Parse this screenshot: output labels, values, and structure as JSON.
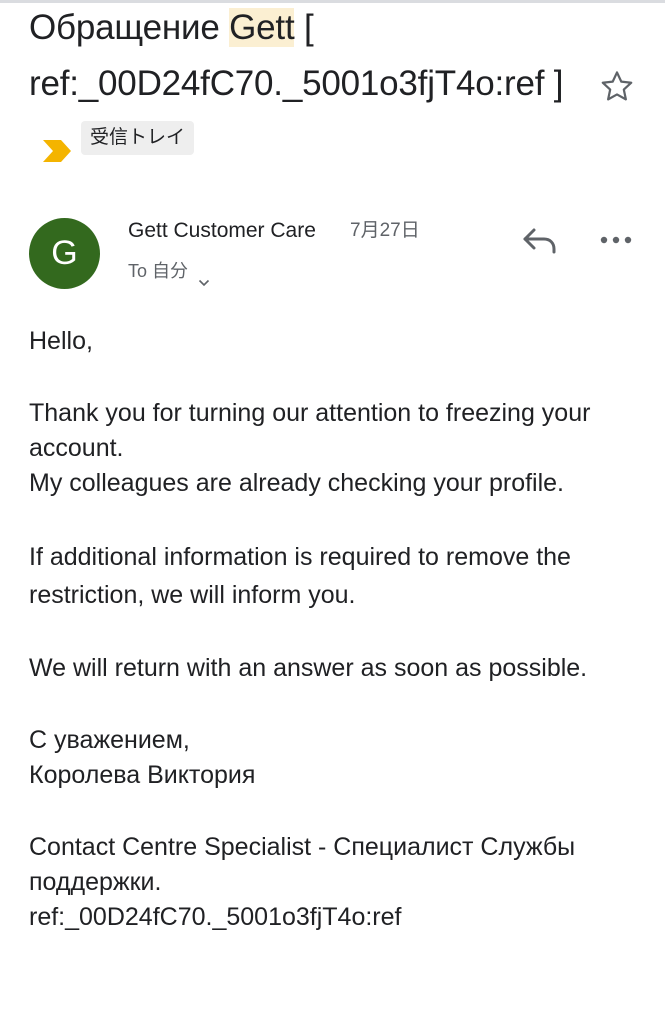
{
  "subject": {
    "text_before": "Обращение ",
    "highlight": "Gett",
    "text_after": " [ ref:_00D24fC70._5001o3fjT4o:ref ]",
    "label": "受信トレイ",
    "importance_icon": "importance-marker-icon",
    "star_icon": "star-outline-icon"
  },
  "message": {
    "avatar_letter": "G",
    "sender": "Gett Customer Care",
    "date": "7月27日",
    "to_text": "To 自分",
    "reply_icon": "reply-icon",
    "more_icon": "more-horizontal-icon",
    "body": {
      "greeting": "Hello,",
      "para1": "Thank you for turning our attention to freezing your account.",
      "para1b": "My colleagues are already checking your profile.",
      "para2": "If additional information is required to remove the restriction, we will inform you.",
      "para3": "We will return with an answer as soon as possible.",
      "sign1": "С уважением,",
      "sign2": "Королева Виктория",
      "footer1": "Contact Centre Specialist - Специалист Службы поддержки.",
      "footer2": "ref:_00D24fC70._5001o3fjT4o:ref"
    }
  },
  "colors": {
    "avatar_bg": "#33691e",
    "importance": "#f4b400",
    "highlight": "#fbefd2"
  }
}
